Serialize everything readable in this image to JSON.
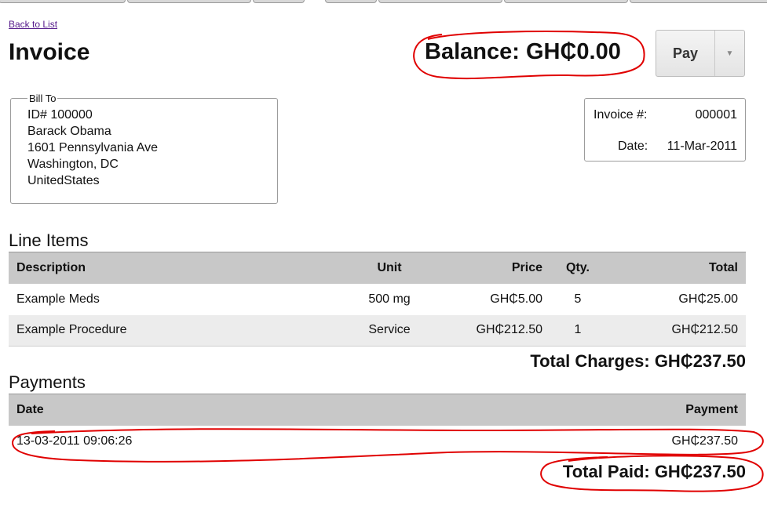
{
  "nav": {
    "back_label": "Back to List"
  },
  "header": {
    "title": "Invoice",
    "balance": "Balance: GH₵0.00",
    "pay_label": "Pay"
  },
  "bill_to": {
    "legend": "Bill To",
    "lines": [
      "ID# 100000",
      "Barack Obama",
      "1601 Pennsylvania Ave",
      "Washington, DC",
      "UnitedStates"
    ]
  },
  "invoice_meta": {
    "number_label": "Invoice #:",
    "number": "000001",
    "date_label": "Date:",
    "date": "11-Mar-2011"
  },
  "line_items": {
    "heading": "Line Items",
    "columns": [
      "Description",
      "Unit",
      "Price",
      "Qty.",
      "Total"
    ],
    "rows": [
      [
        "Example Meds",
        "500 mg",
        "GH₵5.00",
        "5",
        "GH₵25.00"
      ],
      [
        "Example Procedure",
        "Service",
        "GH₵212.50",
        "1",
        "GH₵212.50"
      ]
    ],
    "total": "Total Charges: GH₵237.50"
  },
  "payments": {
    "heading": "Payments",
    "columns": [
      "Date",
      "Payment"
    ],
    "rows": [
      [
        "13-03-2011 09:06:26",
        "GH₵237.50"
      ]
    ],
    "total": "Total Paid: GH₵237.50"
  },
  "annotation": {
    "ink_color": "#e00000"
  },
  "icons": {
    "dropdown": "chevron-down-icon"
  }
}
